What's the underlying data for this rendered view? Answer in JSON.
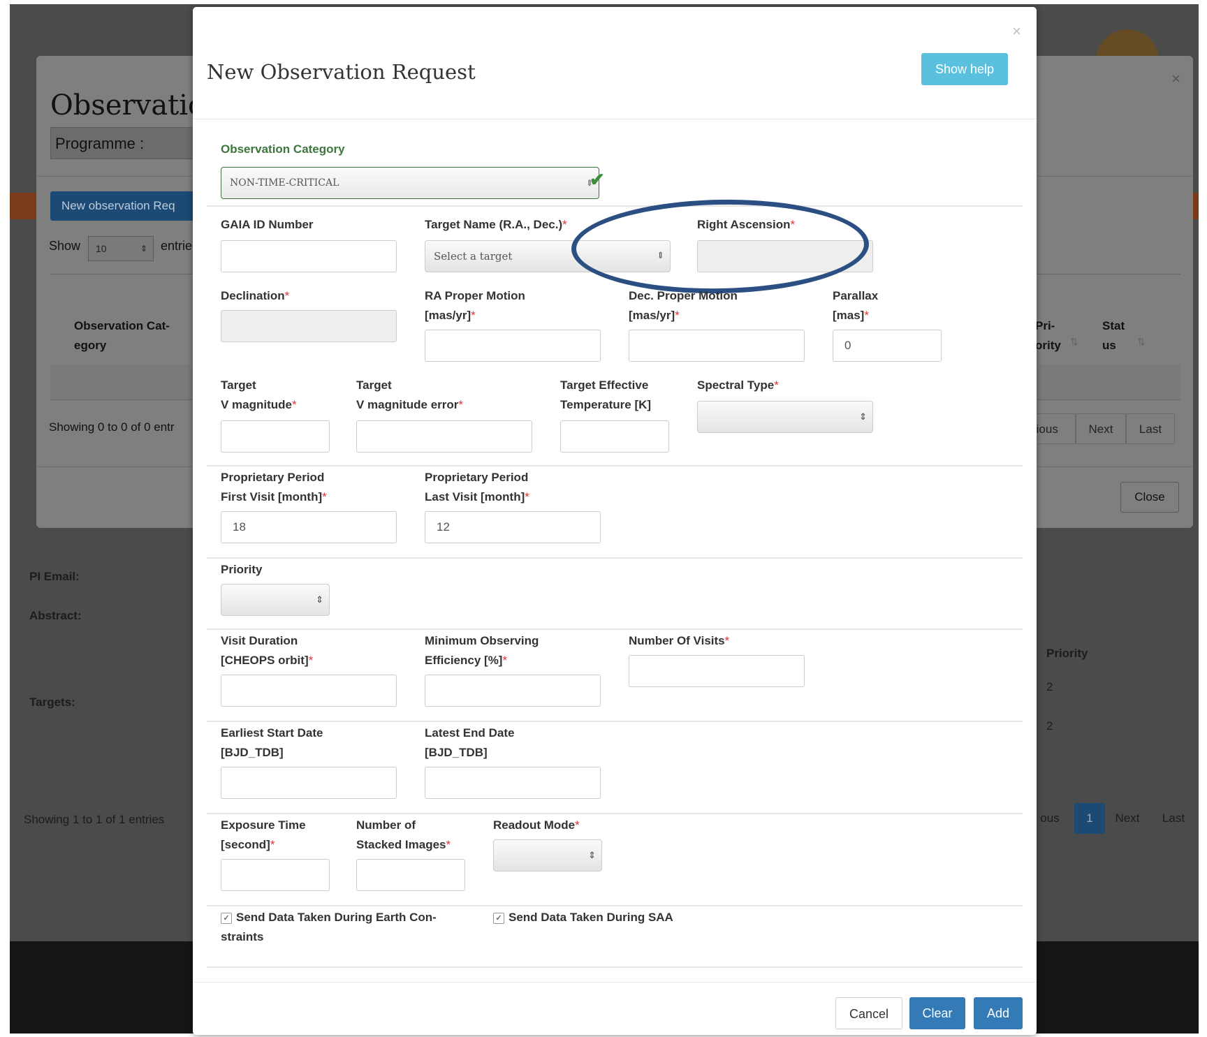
{
  "background": {
    "modal_title": "Observatio",
    "programme_label": "Programme :",
    "new_button": "New observation Req",
    "show_label": "Show",
    "show_value": "10",
    "entries_label": "entrie",
    "col_category": "Observation Cat-\negory",
    "col_priority": "Pri-\nority",
    "col_status": "Stat\nus",
    "showing_text": "Showing 0 to 0 of 0 entr",
    "pager": {
      "previous": "vious",
      "next": "Next",
      "last": "Last"
    },
    "close_button": "Close",
    "pi_email_label": "PI Email:",
    "abstract_label": "Abstract:",
    "targets_label": "Targets:",
    "priority_col": "Priority",
    "priority_values": [
      "2",
      "2"
    ],
    "showing_text_2": "Showing 1 to 1 of 1 entries",
    "pager2": {
      "previous": "ous",
      "page": "1",
      "next": "Next",
      "last": "Last"
    }
  },
  "modal": {
    "title": "New Observation Request",
    "help_button": "Show help",
    "category": {
      "label": "Observation Category",
      "value": "NON-TIME-CRITICAL"
    },
    "fields": {
      "gaia_id": "GAIA ID Number",
      "target_name": "Target Name (R.A., Dec.)",
      "target_placeholder": "Select a target",
      "right_ascension": "Right Ascension",
      "declination": "Declination",
      "ra_pm_1": "RA Proper Motion",
      "ra_pm_2": "[mas/yr]",
      "dec_pm_1": "Dec. Proper Motion",
      "dec_pm_2": "[mas/yr]",
      "parallax_1": "Parallax",
      "parallax_2": "[mas]",
      "parallax_value": "0",
      "vmag_1": "Target",
      "vmag_2": "V magnitude",
      "vmag_err_1": "Target",
      "vmag_err_2": "V magnitude error",
      "teff_1": "Target Effective",
      "teff_2": "Temperature [K]",
      "spectral_type": "Spectral Type",
      "prop_first_1": "Proprietary Period",
      "prop_first_2": "First Visit [month]",
      "prop_first_value": "18",
      "prop_last_1": "Proprietary Period",
      "prop_last_2": "Last Visit [month]",
      "prop_last_value": "12",
      "priority": "Priority",
      "visit_dur_1": "Visit Duration",
      "visit_dur_2": "[CHEOPS orbit]",
      "min_eff_1": "Minimum Observing",
      "min_eff_2": "Efficiency [%]",
      "num_visits": "Number Of Visits",
      "start_1": "Earliest Start Date",
      "start_2": "[BJD_TDB]",
      "end_1": "Latest End Date",
      "end_2": "[BJD_TDB]",
      "exp_1": "Exposure Time",
      "exp_2": "[second]",
      "stack_1": "Number of",
      "stack_2": "Stacked Images",
      "readout": "Readout Mode",
      "earth_1": "Send Data Taken During Earth Con-",
      "earth_2": "straints",
      "saa": "Send Data Taken During SAA"
    },
    "required_mark": "*",
    "checkbox_mark": "✓",
    "buttons": {
      "cancel": "Cancel",
      "clear": "Clear",
      "add": "Add"
    }
  },
  "colors": {
    "primary": "#337ab7",
    "info": "#5bc0de",
    "success": "#3c763d",
    "required": "#e03030",
    "annotation_circle": "#2b4f82"
  },
  "icons": [
    "close-icon",
    "check-icon",
    "select-arrow-icon",
    "sort-icon",
    "checkbox-icon"
  ]
}
